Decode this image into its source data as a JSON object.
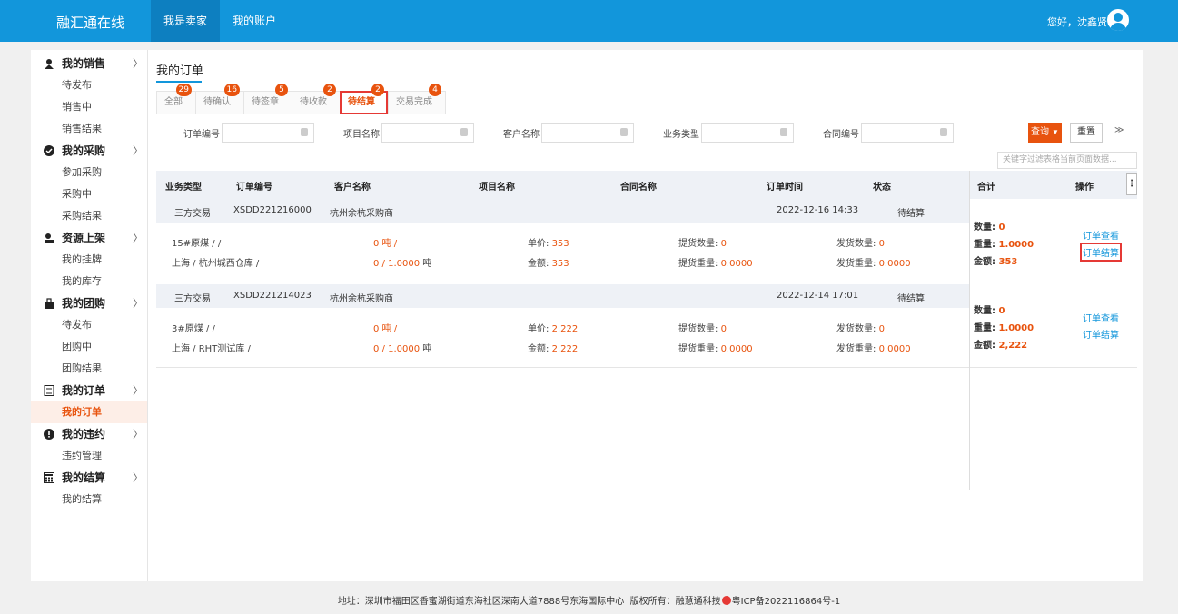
{
  "header": {
    "brand": "融汇通在线",
    "nav": [
      "我是卖家",
      "我的账户"
    ],
    "greeting": "您好，沈鑫贤"
  },
  "sidebar": {
    "groups": [
      {
        "title": "我的销售",
        "icon": "seller-icon",
        "items": [
          "待发布",
          "销售中",
          "销售结果"
        ]
      },
      {
        "title": "我的采购",
        "icon": "purchase-check-icon",
        "items": [
          "参加采购",
          "采购中",
          "采购结果"
        ]
      },
      {
        "title": "资源上架",
        "icon": "shelf-icon",
        "items": [
          "我的挂牌",
          "我的库存"
        ]
      },
      {
        "title": "我的团购",
        "icon": "group-buy-icon",
        "items": [
          "待发布",
          "团购中",
          "团购结果"
        ]
      },
      {
        "title": "我的订单",
        "icon": "order-list-icon",
        "items": [
          "我的订单"
        ]
      },
      {
        "title": "我的违约",
        "icon": "alert-icon",
        "items": [
          "违约管理"
        ]
      },
      {
        "title": "我的结算",
        "icon": "calculator-icon",
        "items": [
          "我的结算"
        ]
      }
    ],
    "arrow": "〉",
    "active_item": "我的订单"
  },
  "main": {
    "title": "我的订单",
    "tabs": [
      {
        "label": "全部",
        "badge": "29"
      },
      {
        "label": "待确认",
        "badge": "16"
      },
      {
        "label": "待签章",
        "badge": "5"
      },
      {
        "label": "待收款",
        "badge": "2"
      },
      {
        "label": "待结算",
        "badge": "2"
      },
      {
        "label": "交易完成",
        "badge": "4"
      }
    ],
    "active_tab": "待结算",
    "filters": {
      "labels": [
        "订单编号",
        "项目名称",
        "客户名称",
        "业务类型",
        "合同编号"
      ],
      "query": "查询",
      "reset": "重置",
      "expand": "≫",
      "keyword_placeholder": "关键字过滤表格当前页面数据..."
    },
    "columns": [
      "业务类型",
      "订单编号",
      "客户名称",
      "项目名称",
      "合同名称",
      "订单时间",
      "状态",
      "合计",
      "操作"
    ],
    "orders": [
      {
        "type": "三方交易",
        "number": "XSDD221216000",
        "customer": "杭州余杭采购商",
        "time": "2022-12-16 14:33",
        "status": "待结算",
        "product": "15#原煤 / /",
        "location": "上海 / 杭州城西仓库 /",
        "qty_a": "0 吨 /",
        "qty_b_val": "0 / 1.0000",
        "qty_b_unit": "吨",
        "price_label": "单价:",
        "price": "353",
        "amount_label": "金额:",
        "amount": "353",
        "pick_qty_label": "提货数量:",
        "pick_qty": "0",
        "pick_wt_label": "提货重量:",
        "pick_wt": "0.0000",
        "ship_qty_label": "发货数量:",
        "ship_qty": "0",
        "ship_wt_label": "发货重量:",
        "ship_wt": "0.0000",
        "sum_qty_label": "数量:",
        "sum_qty": "0",
        "sum_wt_label": "重量:",
        "sum_wt": "1.0000",
        "sum_amt_label": "金额:",
        "sum_amt": "353",
        "op_view": "订单查看",
        "op_settle": "订单结算"
      },
      {
        "type": "三方交易",
        "number": "XSDD221214023",
        "customer": "杭州余杭采购商",
        "time": "2022-12-14 17:01",
        "status": "待结算",
        "product": "3#原煤 / /",
        "location": "上海 / RHT测试库 /",
        "qty_a": "0 吨 /",
        "qty_b_val": "0 / 1.0000",
        "qty_b_unit": "吨",
        "price_label": "单价:",
        "price": "2,222",
        "amount_label": "金额:",
        "amount": "2,222",
        "pick_qty_label": "提货数量:",
        "pick_qty": "0",
        "pick_wt_label": "提货重量:",
        "pick_wt": "0.0000",
        "ship_qty_label": "发货数量:",
        "ship_qty": "0",
        "ship_wt_label": "发货重量:",
        "ship_wt": "0.0000",
        "sum_qty_label": "数量:",
        "sum_qty": "0",
        "sum_wt_label": "重量:",
        "sum_wt": "1.0000",
        "sum_amt_label": "金额:",
        "sum_amt": "2,222",
        "op_view": "订单查看",
        "op_settle": "订单结算"
      }
    ]
  },
  "footer": {
    "address": "地址：深圳市福田区香蜜湖街道东海社区深南大道7888号东海国际中心",
    "copyright": "版权所有：融慧通科技",
    "icp": "粤ICP备2022116864号-1"
  },
  "colors": {
    "primary": "#1296db",
    "accent": "#e8530e",
    "highlight_box": "#e53935"
  }
}
